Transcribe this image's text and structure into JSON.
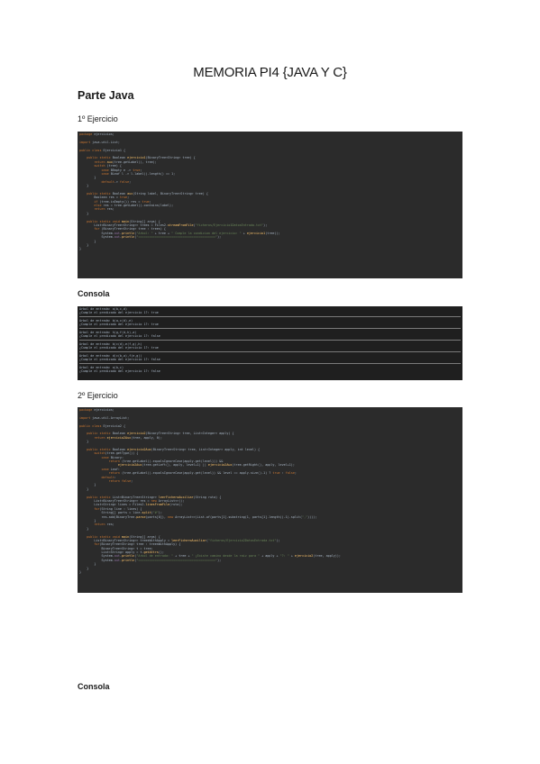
{
  "document": {
    "title": "MEMORIA PI4 {JAVA Y C}",
    "section": "Parte Java",
    "exercises": [
      {
        "heading": "1º Ejercicio",
        "console_label": "Consola"
      },
      {
        "heading": "2º Ejercicio",
        "console_label": "Consola"
      }
    ]
  },
  "code_blocks": {
    "ex1_code": [
      [
        [
          "kw",
          "package "
        ],
        [
          "ty",
          "ejercicios;"
        ]
      ],
      [],
      [
        [
          "kw",
          "import "
        ],
        [
          "ty",
          "java.util.List;"
        ]
      ],
      [],
      [
        [
          "kw",
          "public class "
        ],
        [
          "ty",
          "Ejercicio1 {"
        ]
      ],
      [],
      [
        [
          "ty",
          "    "
        ],
        [
          "kw",
          "public static "
        ],
        [
          "ty",
          "Boolean "
        ],
        [
          "fn",
          "ejercicio1"
        ],
        [
          "ty",
          "(BinaryTree<String> tree) {"
        ]
      ],
      [
        [
          "ty",
          "        "
        ],
        [
          "kw",
          "return "
        ],
        [
          "fn",
          "aux"
        ],
        [
          "ty",
          "(tree.getLabel(), tree);"
        ]
      ],
      [
        [
          "ty",
          "        "
        ],
        [
          "kw",
          "switch "
        ],
        [
          "ty",
          "(tree) {"
        ]
      ],
      [
        [
          "ty",
          "            "
        ],
        [
          "kw",
          "case "
        ],
        [
          "ty",
          "BEmpty e -> "
        ],
        [
          "kw",
          "true"
        ],
        [
          "ty",
          ";"
        ]
      ],
      [
        [
          "ty",
          "            "
        ],
        [
          "kw",
          "case "
        ],
        [
          "ty",
          "BLeaf l -> l.label().length() == 1;"
        ]
      ],
      [
        [
          "ty",
          "        }"
        ]
      ],
      [
        [
          "ty",
          "            "
        ],
        [
          "kw",
          "default"
        ],
        [
          "ty",
          "-> "
        ],
        [
          "kw",
          "false"
        ],
        [
          "ty",
          ";"
        ]
      ],
      [
        [
          "ty",
          "    }"
        ]
      ],
      [],
      [
        [
          "ty",
          "    "
        ],
        [
          "kw",
          "public static "
        ],
        [
          "ty",
          "Boolean "
        ],
        [
          "fn",
          "aux"
        ],
        [
          "ty",
          "(String label, BinaryTree<String> tree) {"
        ]
      ],
      [
        [
          "ty",
          "        Boolean res = "
        ],
        [
          "kw",
          "true"
        ],
        [
          "ty",
          ";"
        ]
      ],
      [
        [
          "ty",
          "        "
        ],
        [
          "kw",
          "if "
        ],
        [
          "ty",
          "(tree.isEmpty()) res = "
        ],
        [
          "kw",
          "true"
        ],
        [
          "ty",
          ";"
        ]
      ],
      [
        [
          "ty",
          "        "
        ],
        [
          "kw",
          "else "
        ],
        [
          "ty",
          "res = tree.getLabel().contains(label);"
        ]
      ],
      [
        [
          "ty",
          "        "
        ],
        [
          "kw",
          "return "
        ],
        [
          "ty",
          "res;"
        ]
      ],
      [
        [
          "ty",
          "    }"
        ]
      ],
      [],
      [
        [
          "ty",
          "    "
        ],
        [
          "kw",
          "public static void "
        ],
        [
          "fn",
          "main"
        ],
        [
          "ty",
          "(String[] args) {"
        ]
      ],
      [
        [
          "ty",
          "        List<BinaryTree<String>> trees = Files2."
        ],
        [
          "fn",
          "streamFromFile"
        ],
        [
          "ty",
          "("
        ],
        [
          "str",
          "\"ficheros/Ejercicio1DatosEntrada.txt\""
        ],
        [
          "ty",
          ");"
        ]
      ],
      [
        [
          "ty",
          "        "
        ],
        [
          "kw",
          "for "
        ],
        [
          "ty",
          "(BinaryTree<String> tree : trees) {"
        ]
      ],
      [
        [
          "ty",
          "            System."
        ],
        [
          "gl",
          "out"
        ],
        [
          "ty",
          "."
        ],
        [
          "fn",
          "println"
        ],
        [
          "ty",
          "("
        ],
        [
          "str",
          "\"Arbol: \""
        ],
        [
          "ty",
          " + tree + "
        ],
        [
          "str",
          "\" Cumple la condicion del ejercicio: \""
        ],
        [
          "ty",
          " + "
        ],
        [
          "fn",
          "ejercicio1"
        ],
        [
          "ty",
          "(tree));"
        ]
      ],
      [
        [
          "ty",
          "            System."
        ],
        [
          "gl",
          "out"
        ],
        [
          "ty",
          "."
        ],
        [
          "fn",
          "println"
        ],
        [
          "ty",
          "("
        ],
        [
          "str",
          "\"==========================================\""
        ],
        [
          "ty",
          ");"
        ]
      ],
      [
        [
          "ty",
          "        }"
        ]
      ],
      [
        [
          "ty",
          "    }"
        ]
      ],
      [
        [
          "ty",
          "}"
        ]
      ]
    ],
    "ex1_console": [
      [
        [
          "ty",
          "Arbol de entrada: a(b,c,d)"
        ]
      ],
      [
        [
          "ty",
          "¿Cumple el predicado del ejercicio 1?: true"
        ]
      ],
      [
        "SEP"
      ],
      [
        [
          "ty",
          "Arbol de entrada: b(a,c(d),e)"
        ]
      ],
      [
        [
          "ty",
          "¿Cumple el predicado del ejercicio 1?: true"
        ]
      ],
      [
        "SEP"
      ],
      [
        [
          "ty",
          "Arbol de entrada: h(g,f(d,h),a)"
        ]
      ],
      [
        [
          "ty",
          "¿Cumple el predicado del ejercicio 1?: false"
        ]
      ],
      [
        "SEP"
      ],
      [
        [
          "ty",
          "Arbol de entrada: b(c(d),e(f,g),h)"
        ]
      ],
      [
        [
          "ty",
          "¿Cumple el predicado del ejercicio 1?: true"
        ]
      ],
      [
        "SEP"
      ],
      [
        [
          "ty",
          "Arbol de entrada: d(c(b,a),f(e,g))"
        ]
      ],
      [
        [
          "ty",
          "¿Cumple el predicado del ejercicio 1?: false"
        ]
      ],
      [
        "SEP"
      ],
      [
        [
          "ty",
          "Arbol de entrada: a(b,c)"
        ]
      ],
      [
        [
          "ty",
          "¿Cumple el predicado del ejercicio 1?: false"
        ]
      ]
    ],
    "ex2_code": [
      [
        [
          "kw",
          "package "
        ],
        [
          "ty",
          "ejercicios;"
        ]
      ],
      [],
      [
        [
          "kw",
          "import "
        ],
        [
          "ty",
          "java.util.ArrayList;"
        ]
      ],
      [],
      [
        [
          "kw",
          "public class "
        ],
        [
          "ty",
          "Ejercicio2 {"
        ]
      ],
      [],
      [
        [
          "ty",
          "    "
        ],
        [
          "kw",
          "public static "
        ],
        [
          "ty",
          "Boolean "
        ],
        [
          "fn",
          "ejercicio2"
        ],
        [
          "ty",
          "(BinaryTree<String> tree, List<Integer> apply) {"
        ]
      ],
      [
        [
          "ty",
          "        "
        ],
        [
          "kw",
          "return "
        ],
        [
          "fn",
          "ejercicio2Aux"
        ],
        [
          "ty",
          "(tree, apply, 0);"
        ]
      ],
      [
        [
          "ty",
          "    }"
        ]
      ],
      [],
      [
        [
          "ty",
          "    "
        ],
        [
          "kw",
          "public static "
        ],
        [
          "ty",
          "Boolean "
        ],
        [
          "fn",
          "ejercicio2Aux"
        ],
        [
          "ty",
          "(BinaryTree<String> tree, List<Integer> apply, int level) {"
        ]
      ],
      [
        [
          "ty",
          "        "
        ],
        [
          "kw",
          "switch"
        ],
        [
          "ty",
          "(tree.getType()) {"
        ]
      ],
      [
        [
          "ty",
          "            "
        ],
        [
          "kw",
          "case "
        ],
        [
          "ty",
          "Binary:"
        ]
      ],
      [
        [
          "ty",
          "                "
        ],
        [
          "kw",
          "return "
        ],
        [
          "ty",
          "(tree.getLabel().equalsIgnoreCase(apply.get(level))) &&"
        ]
      ],
      [
        [
          "ty",
          "                     "
        ],
        [
          "fn",
          "ejercicio2Aux"
        ],
        [
          "ty",
          "(tree.getLeft(), apply, level+1) || "
        ],
        [
          "fn",
          "ejercicio2Aux"
        ],
        [
          "ty",
          "(tree.getRight(), apply, level+1);"
        ]
      ],
      [
        [
          "ty",
          "            "
        ],
        [
          "kw",
          "case "
        ],
        [
          "ty",
          "Leaf:"
        ]
      ],
      [
        [
          "ty",
          "                "
        ],
        [
          "kw",
          "return "
        ],
        [
          "ty",
          "(tree.getLabel().equalsIgnoreCase(apply.get(level)) && level == apply.size()-1) ? "
        ],
        [
          "kw",
          "true "
        ],
        [
          "ty",
          ": "
        ],
        [
          "kw",
          "false"
        ],
        [
          "ty",
          ";"
        ]
      ],
      [
        [
          "ty",
          "            "
        ],
        [
          "kw",
          "default"
        ],
        [
          "ty",
          ":"
        ]
      ],
      [
        [
          "ty",
          "                "
        ],
        [
          "kw",
          "return false"
        ],
        [
          "ty",
          ";"
        ]
      ],
      [
        [
          "ty",
          "        }"
        ]
      ],
      [
        [
          "ty",
          "    }"
        ]
      ],
      [],
      [
        [
          "ty",
          "    "
        ],
        [
          "kw",
          "public static "
        ],
        [
          "ty",
          "List<BinaryTree<String>> "
        ],
        [
          "fn",
          "leerFicheroAuxiliar"
        ],
        [
          "ty",
          "(String ruta) {"
        ]
      ],
      [
        [
          "ty",
          "        List<BinaryTree<String>> res = "
        ],
        [
          "kw",
          "new "
        ],
        [
          "ty",
          "ArrayList<>();"
        ]
      ],
      [
        [
          "ty",
          "        List<String> lines = Files2."
        ],
        [
          "fn",
          "linesFromFile"
        ],
        [
          "ty",
          "(ruta);"
        ]
      ],
      [
        [
          "ty",
          "        "
        ],
        [
          "kw",
          "for"
        ],
        [
          "ty",
          "(String line : lines) {"
        ]
      ],
      [
        [
          "ty",
          "            String[] parts = line."
        ],
        [
          "fn",
          "split"
        ],
        [
          "ty",
          "("
        ],
        [
          "str",
          "\"#\""
        ],
        [
          "ty",
          ");"
        ]
      ],
      [
        [
          "ty",
          "            res.add(BinaryTree."
        ],
        [
          "fn",
          "parse"
        ],
        [
          "ty",
          "(parts[0]), "
        ],
        [
          "kw",
          "new "
        ],
        [
          "ty",
          "ArrayList<>(List.of(parts[1].substring(1, parts[1].length()-1).split("
        ],
        [
          "str",
          "\",\""
        ],
        [
          "ty",
          "))));"
        ]
      ],
      [
        [
          "ty",
          "        }"
        ]
      ],
      [
        [
          "ty",
          "        "
        ],
        [
          "kw",
          "return "
        ],
        [
          "ty",
          "res;"
        ]
      ],
      [
        [
          "ty",
          "    }"
        ]
      ],
      [],
      [
        [
          "ty",
          "    "
        ],
        [
          "kw",
          "public static void "
        ],
        [
          "fn",
          "main"
        ],
        [
          "ty",
          "(String[] args) {"
        ]
      ],
      [
        [
          "ty",
          "        List<BinaryTree<String>> treesWithApply = "
        ],
        [
          "fn",
          "leerFicheroAuxiliar"
        ],
        [
          "ty",
          "("
        ],
        [
          "str",
          "\"ficheros/Ejercicio2DatosEntrada.txt\""
        ],
        [
          "ty",
          ");"
        ]
      ],
      [
        [
          "ty",
          "        "
        ],
        [
          "kw",
          "for"
        ],
        [
          "ty",
          "(BinaryTree<String> tree : treesWithApply) {"
        ]
      ],
      [
        [
          "ty",
          "            BinaryTree<String> t = tree;"
        ]
      ],
      [
        [
          "ty",
          "            List<String> apply = t."
        ],
        [
          "fn",
          "getAttrs"
        ],
        [
          "ty",
          "();"
        ]
      ],
      [
        [
          "ty",
          "            System."
        ],
        [
          "gl",
          "out"
        ],
        [
          "ty",
          "."
        ],
        [
          "fn",
          "println"
        ],
        [
          "ty",
          "("
        ],
        [
          "str",
          "\"Arbol de entrada: \""
        ],
        [
          "ty",
          " + tree + "
        ],
        [
          "str",
          "\" ¿Existe camino desde la raiz para \""
        ],
        [
          "ty",
          " + apply + "
        ],
        [
          "str",
          "\"?: \""
        ],
        [
          "ty",
          " + "
        ],
        [
          "fn",
          "ejercicio2"
        ],
        [
          "ty",
          "(tree, apply));"
        ]
      ],
      [
        [
          "ty",
          "            System."
        ],
        [
          "gl",
          "out"
        ],
        [
          "ty",
          "."
        ],
        [
          "fn",
          "println"
        ],
        [
          "ty",
          "("
        ],
        [
          "str",
          "\"==========================================\""
        ],
        [
          "ty",
          ");"
        ]
      ],
      [
        [
          "ty",
          "        }"
        ]
      ],
      [
        [
          "ty",
          "    }"
        ]
      ],
      [
        [
          "ty",
          "}"
        ]
      ]
    ]
  }
}
